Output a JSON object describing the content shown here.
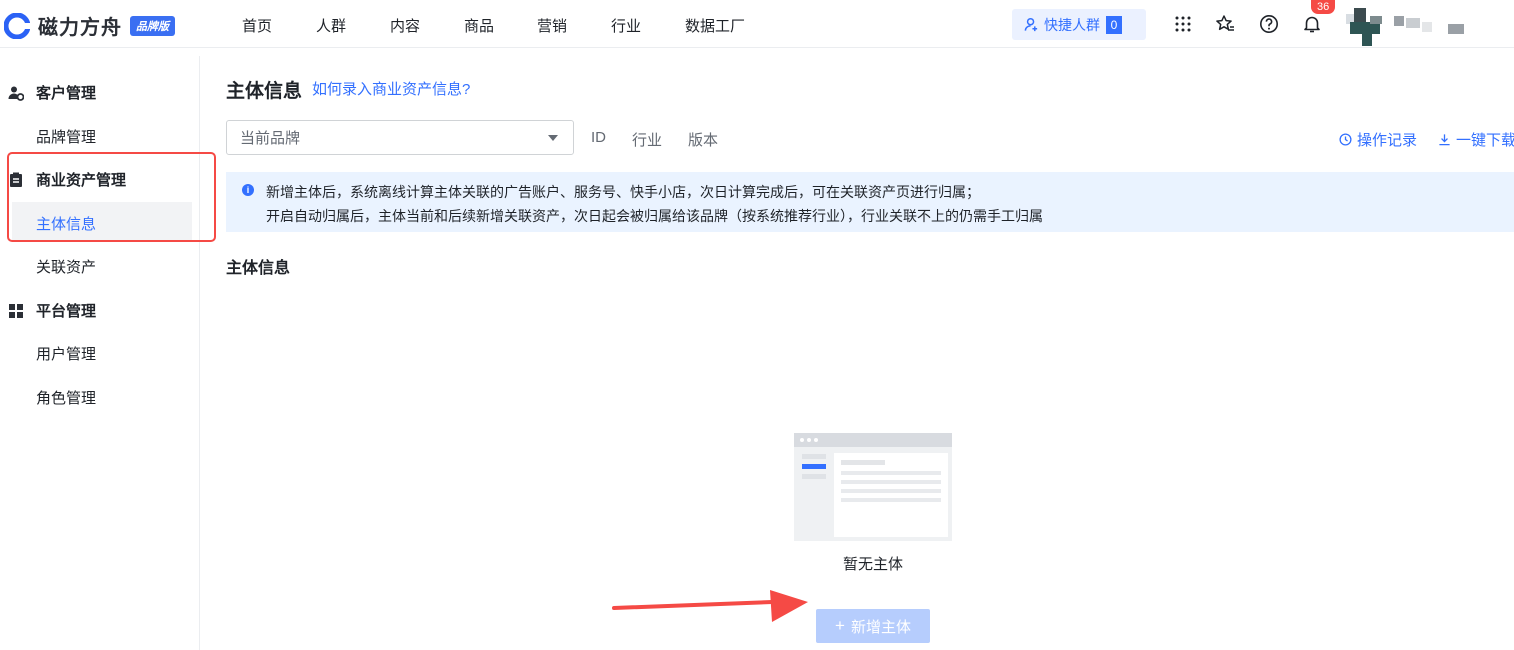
{
  "header": {
    "app_name": "磁力方舟",
    "edition_badge": "品牌版",
    "menu": [
      "首页",
      "人群",
      "内容",
      "商品",
      "营销",
      "行业",
      "数据工厂"
    ],
    "quick_crowd_label": "快捷人群",
    "quick_crowd_count": "0",
    "notification_count": "36"
  },
  "sidebar": {
    "groups": [
      {
        "label": "客户管理",
        "icon": "customer-icon",
        "items": [
          "品牌管理"
        ]
      },
      {
        "label": "商业资产管理",
        "icon": "clipboard-icon",
        "items": [
          "主体信息",
          "关联资产"
        ]
      },
      {
        "label": "平台管理",
        "icon": "grid-icon",
        "items": [
          "用户管理",
          "角色管理"
        ]
      }
    ],
    "active_item": "主体信息"
  },
  "main": {
    "title": "主体信息",
    "help_link": "如何录入商业资产信息?",
    "brand_select_placeholder": "当前品牌",
    "filter_tabs": [
      "ID",
      "行业",
      "版本"
    ],
    "actions": {
      "history": "操作记录",
      "download": "一键下载"
    },
    "notice_lines": [
      "新增主体后，系统离线计算主体关联的广告账户、服务号、快手小店，次日计算完成后，可在关联资产页进行归属；",
      "开启自动归属后，主体当前和后续新增关联资产，次日起会被归属给该品牌（按系统推荐行业），行业关联不上的仍需手工归属"
    ],
    "section_title": "主体信息",
    "empty_text": "暂无主体",
    "add_button": "新增主体"
  },
  "colors": {
    "primary": "#3370ff",
    "annotation_red": "#f54a45",
    "notice_bg": "#eaf3ff",
    "disabled_button": "#b6cdfd"
  }
}
